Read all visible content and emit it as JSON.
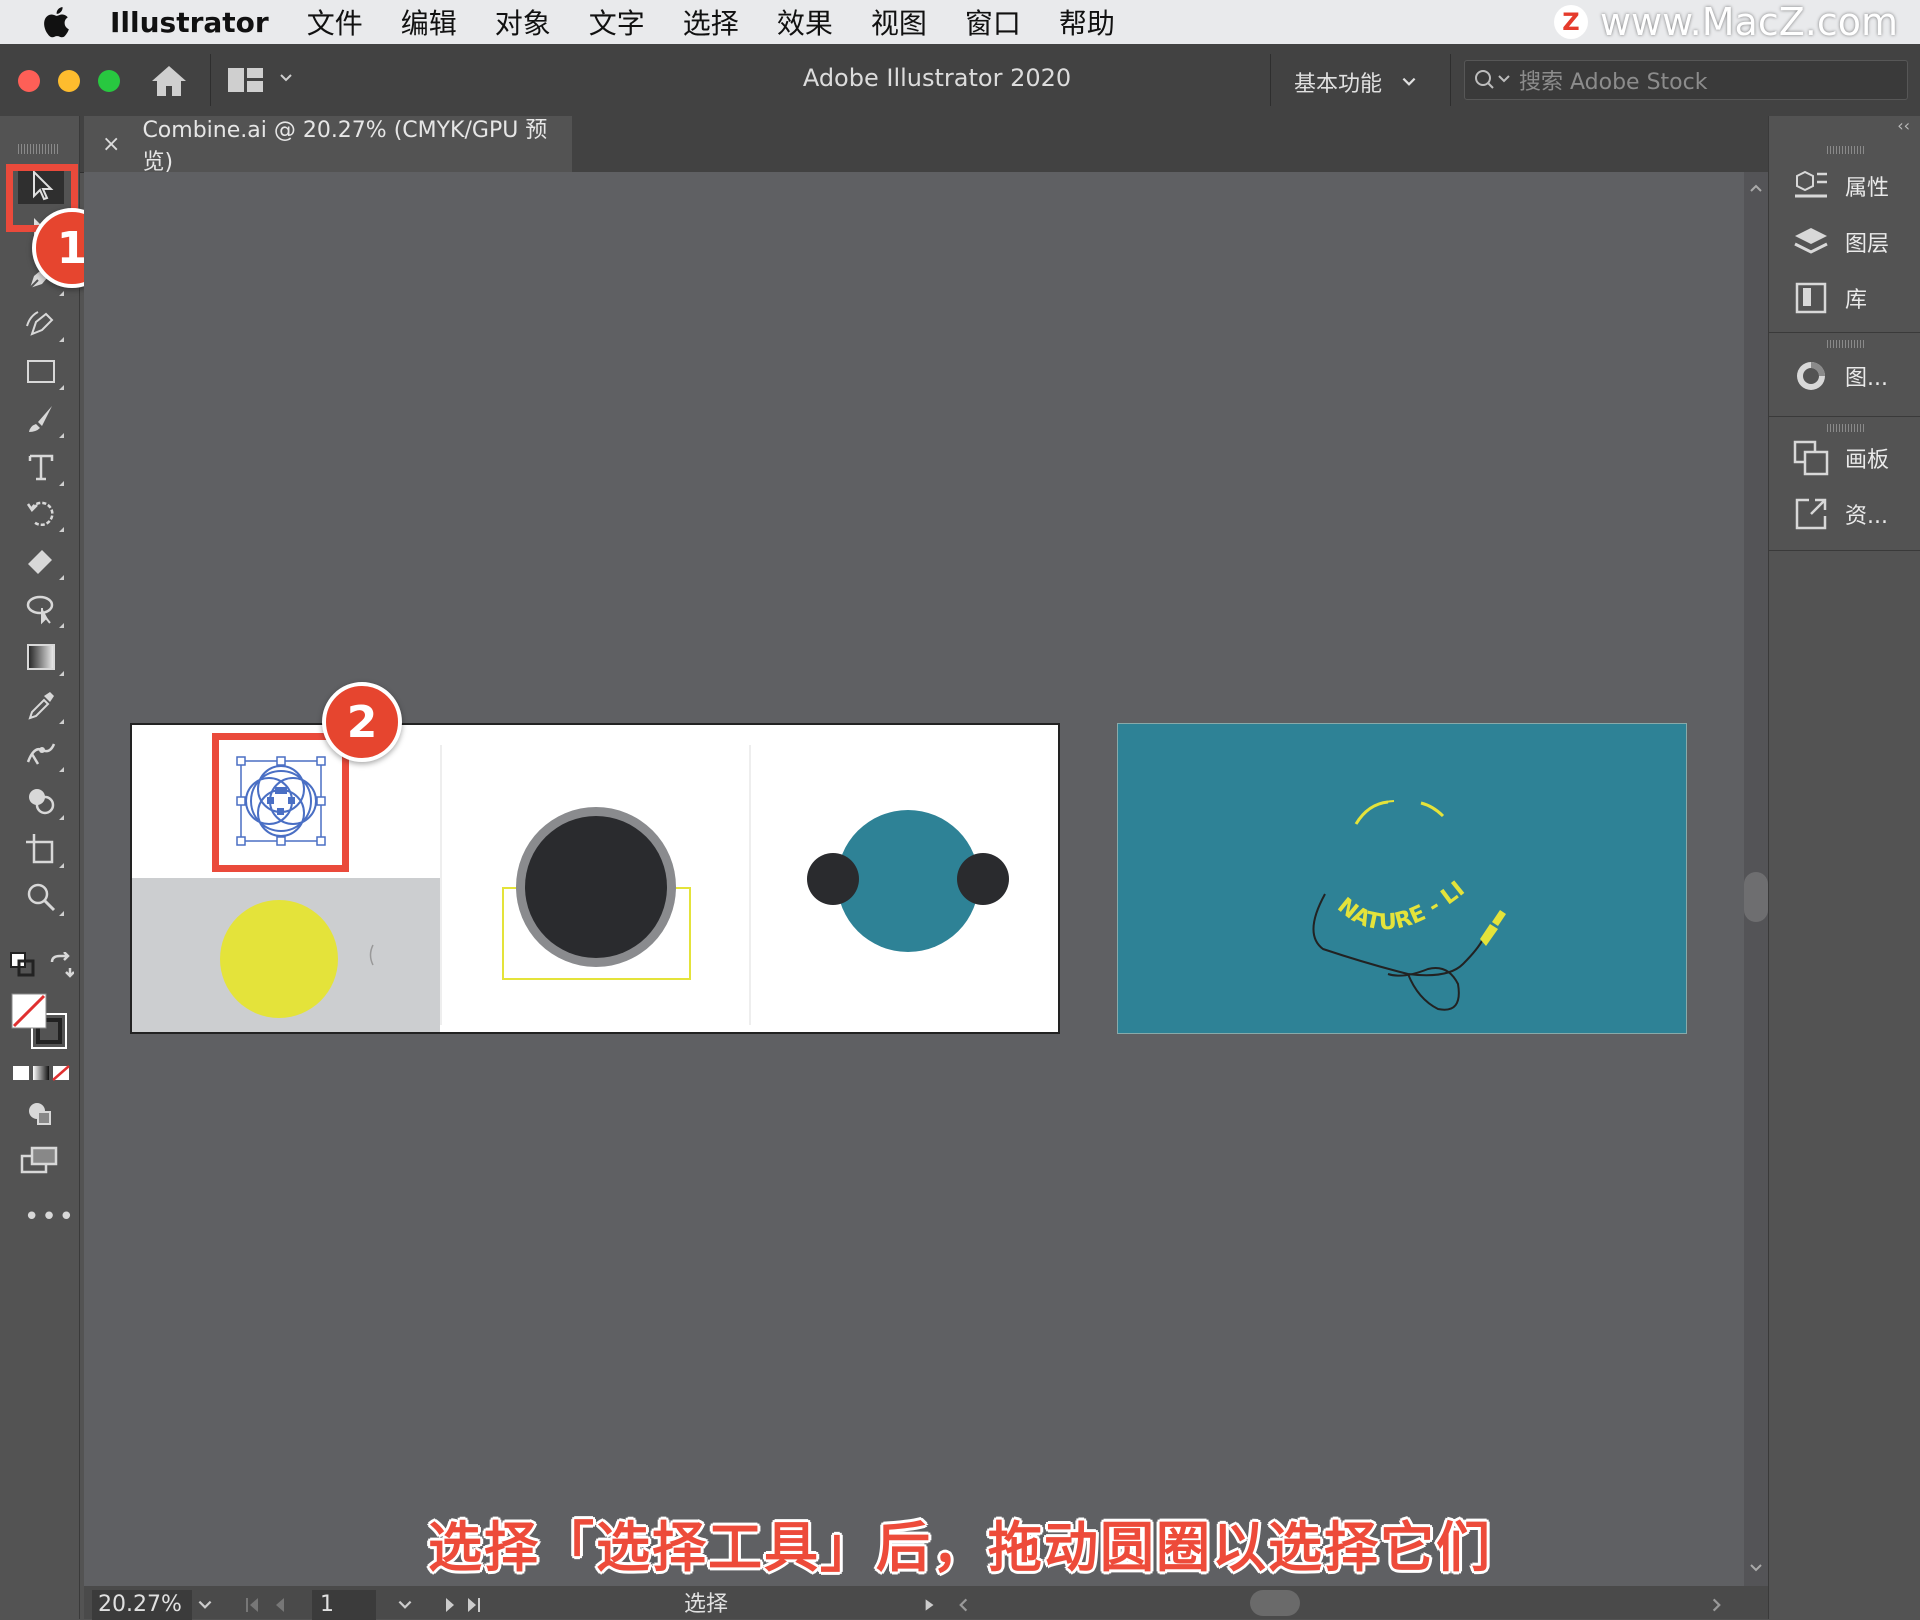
{
  "menubar": {
    "app_name": "Illustrator",
    "items": [
      "文件",
      "编辑",
      "对象",
      "文字",
      "选择",
      "效果",
      "视图",
      "窗口",
      "帮助"
    ],
    "watermark": "www.MacZ.com",
    "watermark_logo": "Z"
  },
  "titlebar": {
    "title": "Adobe Illustrator 2020",
    "workspace": "基本功能",
    "search_placeholder": "搜索 Adobe Stock"
  },
  "tabs": {
    "document": "Combine.ai @ 20.27% (CMYK/GPU 预览)",
    "close_glyph": "×",
    "collapse_left": "››",
    "collapse_right": "‹‹"
  },
  "toolbar": {
    "tools": [
      "selection-tool",
      "direct-selection-tool",
      "pen-tool",
      "curvature-tool",
      "rectangle-tool",
      "paintbrush-tool",
      "type-tool",
      "rotate-tool",
      "eraser-tool",
      "lasso-tool",
      "gradient-tool",
      "eyedropper-tool",
      "puppet-warp-tool",
      "shape-builder-tool",
      "artboard-tool",
      "zoom-tool"
    ],
    "more": "•••"
  },
  "annotations": {
    "step1": "1",
    "step2": "2",
    "caption": "选择「选择工具」后，拖动圆圈以选择它们"
  },
  "artwork": {
    "nature_text": "NATURE - LIVE"
  },
  "right_panel": {
    "items": [
      {
        "label": "属性",
        "icon": "properties-icon"
      },
      {
        "label": "图层",
        "icon": "layers-icon"
      },
      {
        "label": "库",
        "icon": "libraries-icon"
      },
      {
        "label": "图...",
        "icon": "color-guide-icon"
      },
      {
        "label": "画板",
        "icon": "artboards-icon"
      },
      {
        "label": "资...",
        "icon": "asset-export-icon"
      }
    ]
  },
  "statusbar": {
    "zoom": "20.27%",
    "page": "1",
    "label": "选择"
  },
  "colors": {
    "accent_red": "#ea4a3b",
    "teal": "#2e8296",
    "yellow": "#e4e33a",
    "canvas": "#5f6063"
  }
}
